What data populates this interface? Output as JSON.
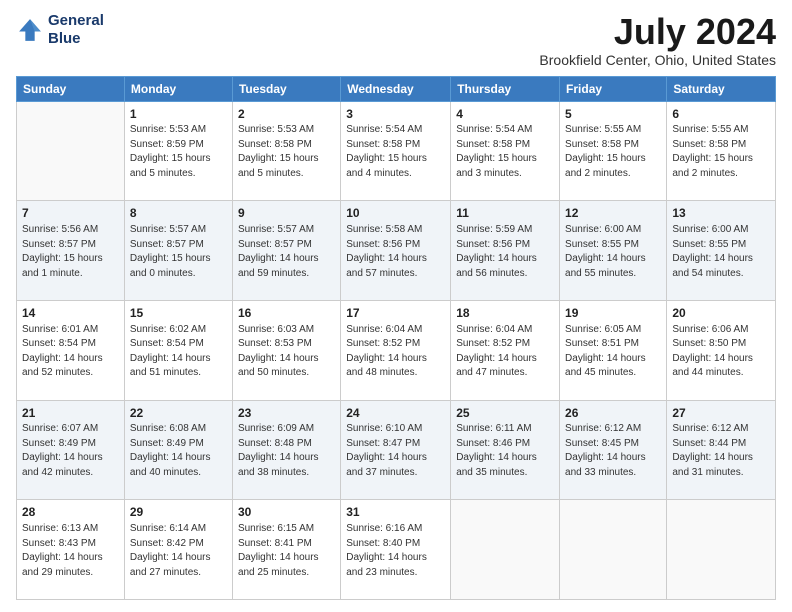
{
  "header": {
    "logo_line1": "General",
    "logo_line2": "Blue",
    "title": "July 2024",
    "subtitle": "Brookfield Center, Ohio, United States"
  },
  "calendar": {
    "days_of_week": [
      "Sunday",
      "Monday",
      "Tuesday",
      "Wednesday",
      "Thursday",
      "Friday",
      "Saturday"
    ],
    "weeks": [
      [
        {
          "day": "",
          "info": ""
        },
        {
          "day": "1",
          "info": "Sunrise: 5:53 AM\nSunset: 8:59 PM\nDaylight: 15 hours\nand 5 minutes."
        },
        {
          "day": "2",
          "info": "Sunrise: 5:53 AM\nSunset: 8:58 PM\nDaylight: 15 hours\nand 5 minutes."
        },
        {
          "day": "3",
          "info": "Sunrise: 5:54 AM\nSunset: 8:58 PM\nDaylight: 15 hours\nand 4 minutes."
        },
        {
          "day": "4",
          "info": "Sunrise: 5:54 AM\nSunset: 8:58 PM\nDaylight: 15 hours\nand 3 minutes."
        },
        {
          "day": "5",
          "info": "Sunrise: 5:55 AM\nSunset: 8:58 PM\nDaylight: 15 hours\nand 2 minutes."
        },
        {
          "day": "6",
          "info": "Sunrise: 5:55 AM\nSunset: 8:58 PM\nDaylight: 15 hours\nand 2 minutes."
        }
      ],
      [
        {
          "day": "7",
          "info": "Sunrise: 5:56 AM\nSunset: 8:57 PM\nDaylight: 15 hours\nand 1 minute."
        },
        {
          "day": "8",
          "info": "Sunrise: 5:57 AM\nSunset: 8:57 PM\nDaylight: 15 hours\nand 0 minutes."
        },
        {
          "day": "9",
          "info": "Sunrise: 5:57 AM\nSunset: 8:57 PM\nDaylight: 14 hours\nand 59 minutes."
        },
        {
          "day": "10",
          "info": "Sunrise: 5:58 AM\nSunset: 8:56 PM\nDaylight: 14 hours\nand 57 minutes."
        },
        {
          "day": "11",
          "info": "Sunrise: 5:59 AM\nSunset: 8:56 PM\nDaylight: 14 hours\nand 56 minutes."
        },
        {
          "day": "12",
          "info": "Sunrise: 6:00 AM\nSunset: 8:55 PM\nDaylight: 14 hours\nand 55 minutes."
        },
        {
          "day": "13",
          "info": "Sunrise: 6:00 AM\nSunset: 8:55 PM\nDaylight: 14 hours\nand 54 minutes."
        }
      ],
      [
        {
          "day": "14",
          "info": "Sunrise: 6:01 AM\nSunset: 8:54 PM\nDaylight: 14 hours\nand 52 minutes."
        },
        {
          "day": "15",
          "info": "Sunrise: 6:02 AM\nSunset: 8:54 PM\nDaylight: 14 hours\nand 51 minutes."
        },
        {
          "day": "16",
          "info": "Sunrise: 6:03 AM\nSunset: 8:53 PM\nDaylight: 14 hours\nand 50 minutes."
        },
        {
          "day": "17",
          "info": "Sunrise: 6:04 AM\nSunset: 8:52 PM\nDaylight: 14 hours\nand 48 minutes."
        },
        {
          "day": "18",
          "info": "Sunrise: 6:04 AM\nSunset: 8:52 PM\nDaylight: 14 hours\nand 47 minutes."
        },
        {
          "day": "19",
          "info": "Sunrise: 6:05 AM\nSunset: 8:51 PM\nDaylight: 14 hours\nand 45 minutes."
        },
        {
          "day": "20",
          "info": "Sunrise: 6:06 AM\nSunset: 8:50 PM\nDaylight: 14 hours\nand 44 minutes."
        }
      ],
      [
        {
          "day": "21",
          "info": "Sunrise: 6:07 AM\nSunset: 8:49 PM\nDaylight: 14 hours\nand 42 minutes."
        },
        {
          "day": "22",
          "info": "Sunrise: 6:08 AM\nSunset: 8:49 PM\nDaylight: 14 hours\nand 40 minutes."
        },
        {
          "day": "23",
          "info": "Sunrise: 6:09 AM\nSunset: 8:48 PM\nDaylight: 14 hours\nand 38 minutes."
        },
        {
          "day": "24",
          "info": "Sunrise: 6:10 AM\nSunset: 8:47 PM\nDaylight: 14 hours\nand 37 minutes."
        },
        {
          "day": "25",
          "info": "Sunrise: 6:11 AM\nSunset: 8:46 PM\nDaylight: 14 hours\nand 35 minutes."
        },
        {
          "day": "26",
          "info": "Sunrise: 6:12 AM\nSunset: 8:45 PM\nDaylight: 14 hours\nand 33 minutes."
        },
        {
          "day": "27",
          "info": "Sunrise: 6:12 AM\nSunset: 8:44 PM\nDaylight: 14 hours\nand 31 minutes."
        }
      ],
      [
        {
          "day": "28",
          "info": "Sunrise: 6:13 AM\nSunset: 8:43 PM\nDaylight: 14 hours\nand 29 minutes."
        },
        {
          "day": "29",
          "info": "Sunrise: 6:14 AM\nSunset: 8:42 PM\nDaylight: 14 hours\nand 27 minutes."
        },
        {
          "day": "30",
          "info": "Sunrise: 6:15 AM\nSunset: 8:41 PM\nDaylight: 14 hours\nand 25 minutes."
        },
        {
          "day": "31",
          "info": "Sunrise: 6:16 AM\nSunset: 8:40 PM\nDaylight: 14 hours\nand 23 minutes."
        },
        {
          "day": "",
          "info": ""
        },
        {
          "day": "",
          "info": ""
        },
        {
          "day": "",
          "info": ""
        }
      ]
    ]
  }
}
